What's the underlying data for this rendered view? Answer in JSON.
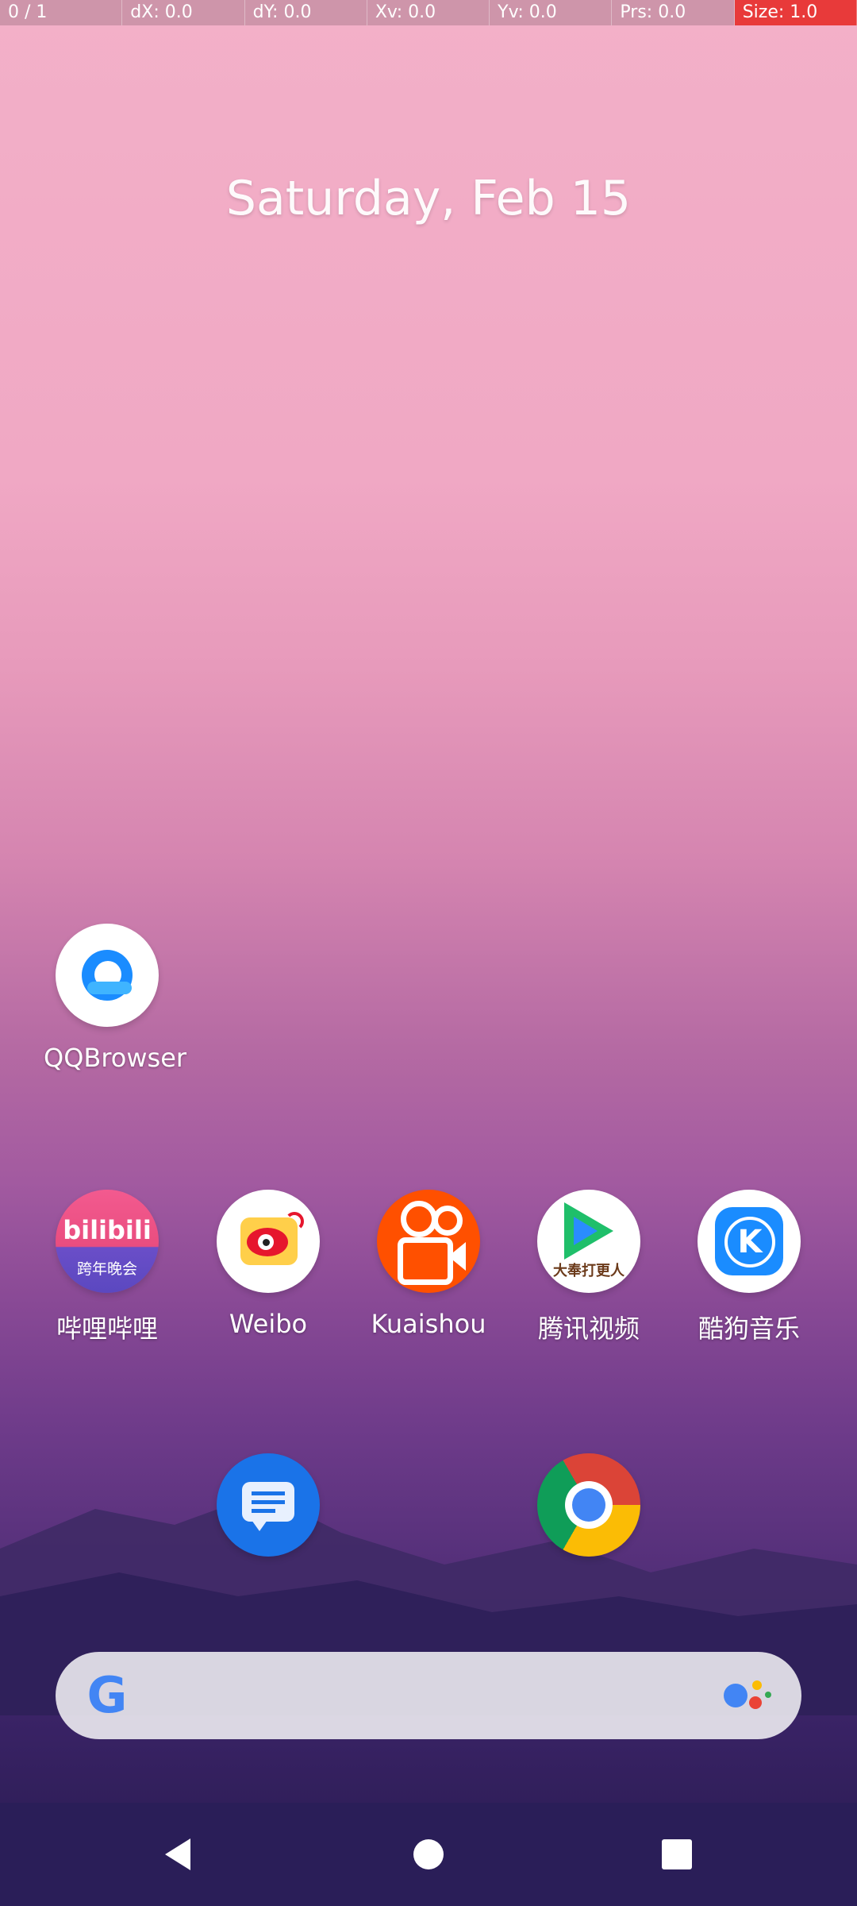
{
  "overlay": {
    "pointers": "0 / 1",
    "dx": "dX: 0.0",
    "dy": "dY: 0.0",
    "xv": "Xv: 0.0",
    "yv": "Yv: 0.0",
    "prs": "Prs: 0.0",
    "size": "Size: 1.0"
  },
  "home": {
    "date": "Saturday, Feb 15"
  },
  "apps": {
    "qqbrowser": "QQBrowser",
    "bilibili": "哔哩哔哩",
    "bilibili_badge_top": "bilibili",
    "bilibili_badge_bottom": "跨年晚会",
    "weibo": "Weibo",
    "kuaishou": "Kuaishou",
    "tencent_video": "腾讯视频",
    "tencent_video_badge": "大奉打更人",
    "kugou": "酷狗音乐",
    "kugou_letter": "K"
  },
  "search": {
    "google_letter": "G"
  },
  "colors": {
    "overlay_size_bg": "#e83a3a",
    "navbar": "#2a1e58"
  }
}
